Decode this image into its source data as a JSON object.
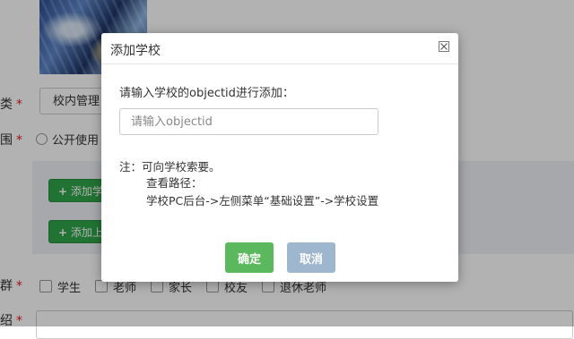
{
  "background": {
    "type_label": "类",
    "type_select_value": "校内管理",
    "scope_label": "围",
    "scope_option": "公开使用",
    "add_button_1": "添加学",
    "add_button_2": "添加上",
    "group_label": "群",
    "group_options": [
      "学生",
      "老师",
      "家长",
      "校友",
      "退休老师"
    ],
    "intro_label": "绍",
    "required_mark": "*"
  },
  "dialog": {
    "title": "添加学校",
    "prompt": "请输入学校的objectid进行添加：",
    "input_placeholder": "请输入objectid",
    "input_value": "",
    "note_line1": "注：可向学校索要。",
    "note_line2": "查看路径：",
    "note_line3": "学校PC后台->左侧菜单“基础设置”->学校设置",
    "ok_label": "确定",
    "cancel_label": "取消"
  },
  "icons": {
    "close": "close-icon",
    "plus": "plus-icon"
  },
  "colors": {
    "ok_button": "#5cb85c",
    "cancel_button": "#9fb6cf",
    "add_button": "#2fa54a",
    "required": "#e02020"
  }
}
